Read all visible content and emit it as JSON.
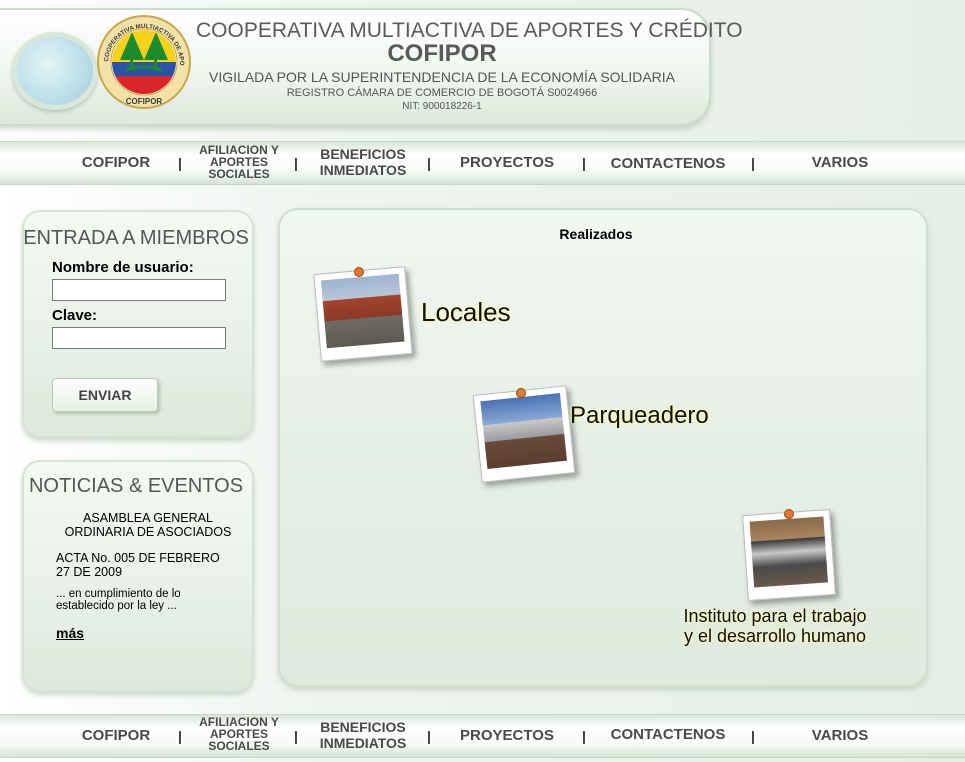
{
  "header": {
    "title": "COOPERATIVA MULTIACTIVA DE APORTES Y CRÉDITO",
    "subtitle": "COFIPOR",
    "line1": "VIGILADA POR LA SUPERINTENDENCIA DE LA ECONOMÍA SOLIDARIA",
    "line2": "REGISTRO CÁMARA DE COMERCIO DE BOGOTÁ S0024966",
    "line3": "NIT: 900018226-1",
    "logo": {
      "ring_text": "COOPERATIVA MULTIACTIVA DE APORTES Y CREDITO",
      "bottom_text": "COFIPOR",
      "icon": "tree-flag-emblem"
    }
  },
  "nav": {
    "cofipor": "COFIPOR",
    "afiliacion_1": "AFILIACION Y",
    "afiliacion_2": "APORTES",
    "afiliacion_3": "SOCIALES",
    "beneficios_1": "BENEFICIOS",
    "beneficios_2": "INMEDIATOS",
    "proyectos": "PROYECTOS",
    "contactenos": "CONTACTENOS",
    "varios": "VARIOS",
    "separator": "|"
  },
  "login": {
    "title": "ENTRADA A MIEMBROS",
    "user_label": "Nombre de usuario:",
    "user_value": "",
    "pass_label": "Clave:",
    "pass_value": "",
    "submit": "ENVIAR"
  },
  "news": {
    "title": "NOTICIAS & EVENTOS",
    "headline_1": "ASAMBLEA GENERAL",
    "headline_2": "ORDINARIA DE ASOCIADOS",
    "acta_1": "ACTA No. 005 DE FEBRERO",
    "acta_2": "27 DE 2009",
    "excerpt_1": "... en cumplimiento de lo",
    "excerpt_2": "establecido por la ley ...",
    "more": "más"
  },
  "main": {
    "heading": "Realizados",
    "items": [
      {
        "caption": "Locales"
      },
      {
        "caption": "Parqueadero"
      },
      {
        "caption_1": "Instituto para el trabajo",
        "caption_2": "y el desarrollo humano"
      }
    ],
    "accent_pin": "#e07a2e",
    "caption_glow": "#fff8b0"
  },
  "colors": {
    "panel_border": "#d4e4d4",
    "panel_fill": "#e7f0e7",
    "text_gray": "#555555"
  }
}
